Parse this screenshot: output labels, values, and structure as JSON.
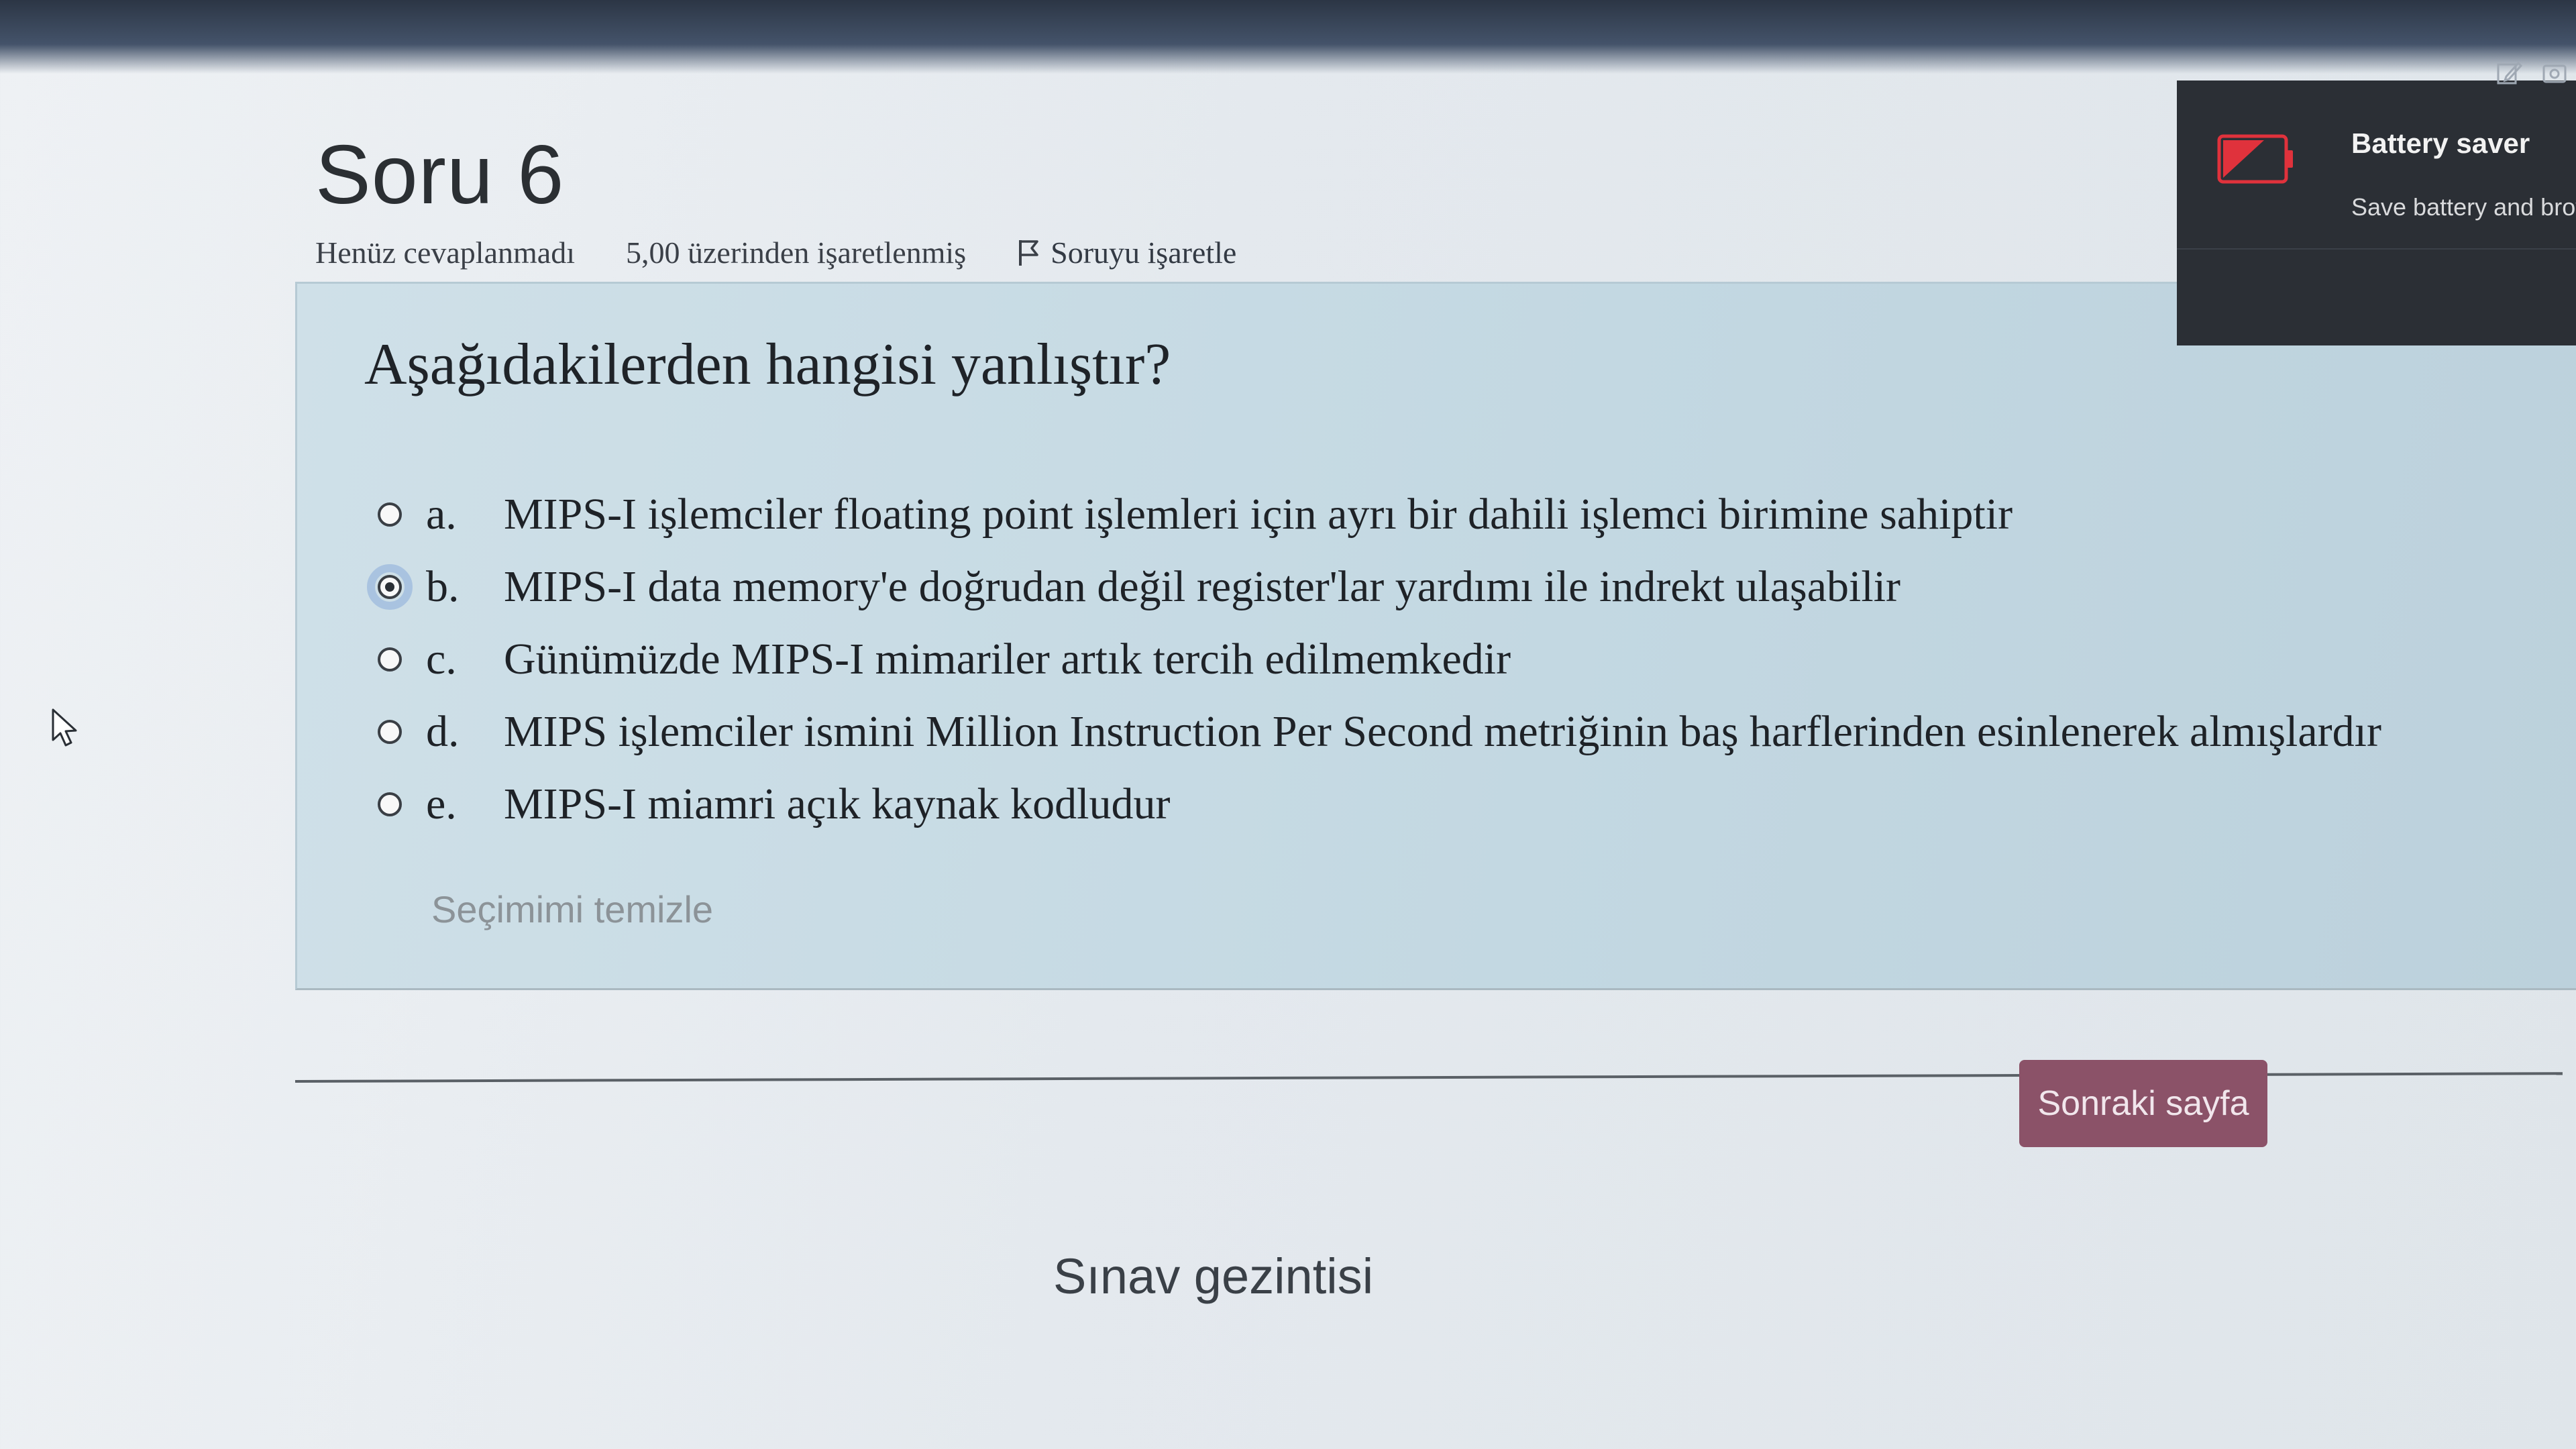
{
  "question": {
    "title": "Soru 6",
    "status": "Henüz cevaplanmadı",
    "grade": "5,00 üzerinden işaretlenmiş",
    "flag_label": "Soruyu işaretle",
    "text": "Aşağıdakilerden hangisi yanlıştır?",
    "answers": [
      {
        "letter": "a.",
        "text": "MIPS-I işlemciler floating point işlemleri için ayrı bir dahili işlemci birimine sahiptir",
        "selected": false
      },
      {
        "letter": "b.",
        "text": "MIPS-I data memory'e doğrudan değil register'lar yardımı ile indrekt ulaşabilir",
        "selected": true
      },
      {
        "letter": "c.",
        "text": "Günümüzde MIPS-I mimariler artık tercih edilmemkedir",
        "selected": false
      },
      {
        "letter": "d.",
        "text": "MIPS işlemciler ismini Million Instruction Per Second metriğinin baş harflerinden esinlenerek almışlardır",
        "selected": false
      },
      {
        "letter": "e.",
        "text": "MIPS-I miamri açık kaynak kodludur",
        "selected": false
      }
    ],
    "clear_label": "Seçimimi temizle"
  },
  "navigation": {
    "next_label": "Sonraki sayfa",
    "exam_nav_title": "Sınav gezintisi"
  },
  "battery_popup": {
    "title": "Battery saver",
    "text": "Save battery and brov",
    "icon": "battery-low-icon"
  },
  "colors": {
    "question_box": "#c8dbe4",
    "next_button": "#8b5268",
    "popup_bg": "#2b2f35",
    "battery_red": "#e0323c"
  }
}
